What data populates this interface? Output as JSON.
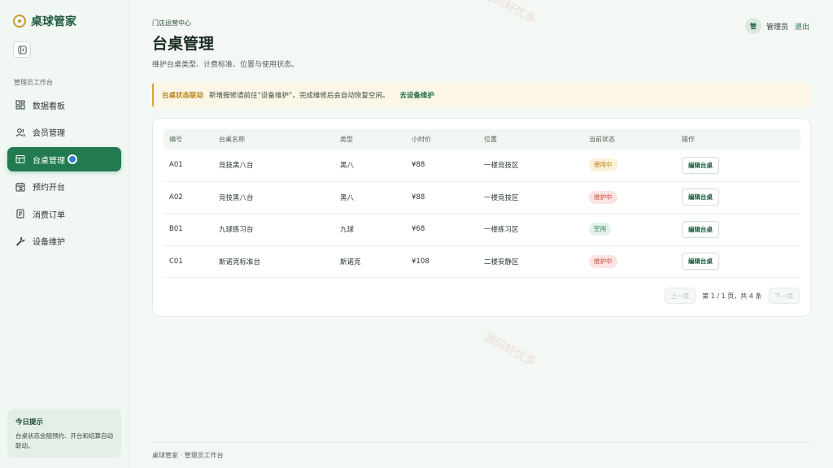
{
  "app": {
    "name": "桌球管家"
  },
  "sidebar": {
    "section_title": "管理员工作台",
    "items": [
      {
        "label": "数据看板",
        "icon": "dashboard-icon"
      },
      {
        "label": "会员管理",
        "icon": "users-icon"
      },
      {
        "label": "台桌管理",
        "icon": "table-icon",
        "active": true
      },
      {
        "label": "预约开台",
        "icon": "calendar-icon"
      },
      {
        "label": "消费订单",
        "icon": "receipt-icon"
      },
      {
        "label": "设备维护",
        "icon": "wrench-icon"
      }
    ],
    "tip": {
      "title": "今日提示",
      "text": "台桌状态会随预约、开台和结算自动联动。"
    }
  },
  "header": {
    "eyebrow": "门店运营中心",
    "title": "台桌管理",
    "description": "维护台桌类型、计费标准、位置与使用状态。",
    "avatar_text": "管",
    "user_name": "管理员",
    "logout_label": "退出"
  },
  "banner": {
    "title": "台桌状态联动",
    "text": "新增报修请前往“设备维护”，完成维修后会自动恢复空闲。",
    "link": "去设备维护"
  },
  "table": {
    "columns": [
      "编号",
      "台桌名称",
      "类型",
      "小时价",
      "位置",
      "当前状态",
      "操作"
    ],
    "rows": [
      {
        "id": "A01",
        "name": "竞技黑八台",
        "type": "黑八",
        "price": "¥88",
        "location": "一楼竞技区",
        "status": "使用中",
        "status_kind": "inuse",
        "action": "编辑台桌"
      },
      {
        "id": "A02",
        "name": "竞技黑八台",
        "type": "黑八",
        "price": "¥88",
        "location": "一楼竞技区",
        "status": "维护中",
        "status_kind": "maint",
        "action": "编辑台桌"
      },
      {
        "id": "B01",
        "name": "九球练习台",
        "type": "九球",
        "price": "¥68",
        "location": "一楼练习区",
        "status": "空闲",
        "status_kind": "idle",
        "action": "编辑台桌"
      },
      {
        "id": "C01",
        "name": "斯诺克标准台",
        "type": "斯诺克",
        "price": "¥108",
        "location": "二楼安静区",
        "status": "维护中",
        "status_kind": "maint",
        "action": "编辑台桌"
      }
    ]
  },
  "pagination": {
    "prev_label": "上一页",
    "info": "第 1 / 1 页，共 4 条",
    "next_label": "下一页"
  },
  "footer": {
    "text": "桌球管家 · 管理员工作台"
  },
  "watermark": {
    "text": "源码好优多"
  },
  "colors": {
    "primary": "#217a50",
    "brand_gold": "#c99a2e",
    "status_inuse": "#b98018",
    "status_maint": "#c84b40",
    "status_idle": "#2a7a4d"
  }
}
